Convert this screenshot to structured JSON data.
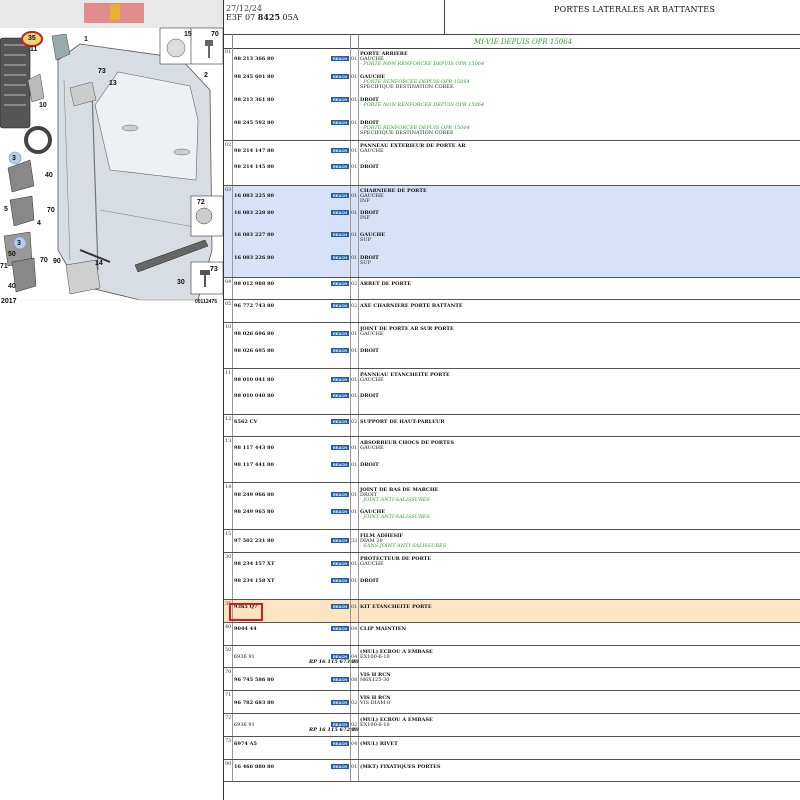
{
  "header": {
    "date": "27/12/24",
    "code_prefix": "E3F 07 ",
    "code_bold": "8425",
    "code_suffix": " 05A",
    "title": "PORTES LATERALES AR BATTANTES"
  },
  "subheader": {
    "text": "MI-VIE DEPUIS OPR 15064"
  },
  "diagram": {
    "callouts": [
      "35",
      "15",
      "70",
      "1",
      "2",
      "73",
      "13",
      "10",
      "11",
      "3",
      "40",
      "5",
      "70",
      "4",
      "72",
      "3",
      "50",
      "70",
      "71",
      "90",
      "14",
      "40",
      "2017",
      "30",
      "73",
      "00112475"
    ],
    "highlight_callout_color": "#d01e1e"
  },
  "badge_label": "REACH",
  "groups": [
    {
      "num": "01",
      "rows": [
        {
          "ref": "98 213 366 80",
          "qty": "01",
          "desc": "PORTE ARRIERE",
          "sub": "GAUCHE",
          "notes": [
            "- PORTE NON RENFORCEE DEPUIS OPR 15064"
          ]
        },
        {
          "ref": "98 245 601 80",
          "qty": "01",
          "desc": "GAUCHE",
          "notes": [
            "- PORTE RENFORCEE DEPUIS OPR 15064"
          ],
          "notes_black": [
            "SPECIFIQUE DESTINATION COREE"
          ]
        },
        {
          "ref": "98 213 361 80",
          "qty": "01",
          "desc": "DROIT",
          "notes": [
            "- PORTE NON RENFORCEE DEPUIS OPR 15064"
          ]
        },
        {
          "ref": "98 245 592 80",
          "qty": "01",
          "desc": "DROIT",
          "notes": [
            "- PORTE RENFORCEE DEPUIS OPR 15064"
          ],
          "notes_black": [
            "SPECIFIQUE DESTINATION COREE"
          ]
        }
      ]
    },
    {
      "num": "02",
      "rows": [
        {
          "ref": "98 214 147 80",
          "qty": "01",
          "desc": "PANNEAU EXTERIEUR DE PORTE AR",
          "sub": "GAUCHE"
        },
        {
          "ref": "98 214 145 80",
          "qty": "01",
          "desc": "DROIT"
        }
      ]
    },
    {
      "num": "03",
      "rows": [
        {
          "ref": "16 083 225 80",
          "qty": "01",
          "desc": "CHARNIERE DE PORTE",
          "sub": "GAUCHE",
          "notes_black": [
            "INF"
          ]
        },
        {
          "ref": "16 083 228 80",
          "qty": "01",
          "desc": "DROIT",
          "notes_black": [
            "INF"
          ]
        },
        {
          "ref": "16 083 227 80",
          "qty": "01",
          "desc": "GAUCHE",
          "notes_black": [
            "SUP"
          ]
        },
        {
          "ref": "16 083 226 80",
          "qty": "01",
          "desc": "DROIT",
          "notes_black": [
            "SUP"
          ]
        }
      ]
    },
    {
      "num": "04",
      "rows": [
        {
          "ref": "98 012 988 80",
          "qty": "02",
          "desc": "ARRET DE PORTE"
        }
      ]
    },
    {
      "num": "05",
      "rows": [
        {
          "ref": "96 772 743 80",
          "qty": "02",
          "desc": "AXE CHARNIERE PORTE BATTANTE"
        }
      ]
    },
    {
      "num": "10",
      "rows": [
        {
          "ref": "98 026 696 80",
          "qty": "01",
          "desc": "JOINT DE PORTE AR SUR PORTE",
          "sub": "GAUCHE"
        },
        {
          "ref": "98 026 695 80",
          "qty": "01",
          "desc": "DROIT"
        }
      ]
    },
    {
      "num": "11",
      "rows": [
        {
          "ref": "98 010 041 80",
          "qty": "01",
          "desc": "PANNEAU ETANCHEITE PORTE",
          "sub": "GAUCHE"
        },
        {
          "ref": "98 010 040 80",
          "qty": "01",
          "desc": "DROIT"
        }
      ]
    },
    {
      "num": "12",
      "rows": [
        {
          "ref": "6562 CV",
          "qty": "02",
          "desc": "SUPPORT DE HAUT-PARLEUR"
        }
      ]
    },
    {
      "num": "13",
      "rows": [
        {
          "ref": "98 117 443 80",
          "qty": "01",
          "desc": "ABSORBEUR CHOCS DE PORTES",
          "sub": "GAUCHE"
        },
        {
          "ref": "98 117 441 80",
          "qty": "01",
          "desc": "DROIT"
        }
      ]
    },
    {
      "num": "14",
      "rows": [
        {
          "ref": "98 249 966 80",
          "qty": "01",
          "desc": "JOINT DE BAS DE MARCHE",
          "sub": "DROIT",
          "notes": [
            "- JOINT ANTI-SALISSURES"
          ]
        },
        {
          "ref": "98 249 965 80",
          "qty": "01",
          "desc": "GAUCHE",
          "notes": [
            "- JOINT ANTI-SALISSURES"
          ]
        }
      ]
    },
    {
      "num": "15",
      "rows": [
        {
          "ref": "97 502 231 80",
          "qty": "32",
          "desc": "FILM ADHESIF",
          "sub": "DIAM 20",
          "notes": [
            "- SANS JOINT ANTI-SALISSURES"
          ]
        }
      ]
    },
    {
      "num": "30",
      "rows": [
        {
          "ref": "98 234 157 XT",
          "qty": "01",
          "desc": "PROTECTEUR DE PORTE",
          "sub": "GAUCHE"
        },
        {
          "ref": "98 234 158 XT",
          "qty": "01",
          "desc": "DROIT"
        }
      ]
    },
    {
      "num": "35",
      "rows": [
        {
          "ref": "9365 Q7",
          "qty": "01",
          "desc": "KIT ETANCHEITE PORTE"
        }
      ]
    },
    {
      "num": "40",
      "rows": [
        {
          "ref": "9044 44",
          "qty": "04",
          "desc": "CLIP MAINTIEN"
        }
      ]
    },
    {
      "num": "50",
      "rows": [
        {
          "ref": "6936 91",
          "qty": "04",
          "desc": "(MUL) ECROU A EMBASE",
          "sub": "EX100-6-10",
          "rp": "RP 16 115 673 80",
          "rp_qty": "01"
        }
      ]
    },
    {
      "num": "70",
      "rows": [
        {
          "ref": "96 745 586 80",
          "qty": "08",
          "desc": "VIS H RCN",
          "sub": "M6X125-30"
        }
      ]
    },
    {
      "num": "71",
      "rows": [
        {
          "ref": "96 782 683 80",
          "qty": "02",
          "desc": "VIS H RCN",
          "sub": "VIS DIAM 8"
        }
      ]
    },
    {
      "num": "72",
      "rows": [
        {
          "ref": "6936 91",
          "qty": "02",
          "desc": "(MUL) ECROU A EMBASE",
          "sub": "EX100-6-10",
          "rp": "RP 16 115 672 80",
          "rp_qty": "01"
        }
      ]
    },
    {
      "num": "73",
      "rows": [
        {
          "ref": "6974 A5",
          "qty": "04",
          "desc": "(MUL) RIVET"
        }
      ]
    },
    {
      "num": "90",
      "rows": [
        {
          "ref": "16 466 880 80",
          "qty": "01",
          "desc": "(MKT) FIXATIQUES PORTES"
        }
      ]
    }
  ]
}
